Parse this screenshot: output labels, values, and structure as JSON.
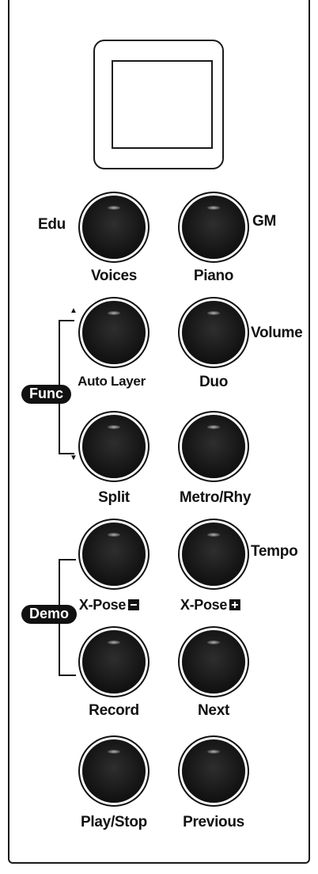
{
  "display": {
    "name": "lcd-display"
  },
  "buttons": {
    "voices": "Voices",
    "piano": "Piano",
    "auto_layer": "Auto Layer",
    "duo": "Duo",
    "split": "Split",
    "metro_rhy": "Metro/Rhy",
    "xpose_minus": "X-Pose",
    "xpose_plus": "X-Pose",
    "record": "Record",
    "next": "Next",
    "play_stop": "Play/Stop",
    "previous": "Previous"
  },
  "secondary": {
    "edu": "Edu",
    "gm": "GM",
    "volume": "Volume",
    "tempo": "Tempo"
  },
  "tags": {
    "func": "Func",
    "demo": "Demo"
  },
  "arrows": {
    "up": "▲",
    "down": "▼"
  }
}
